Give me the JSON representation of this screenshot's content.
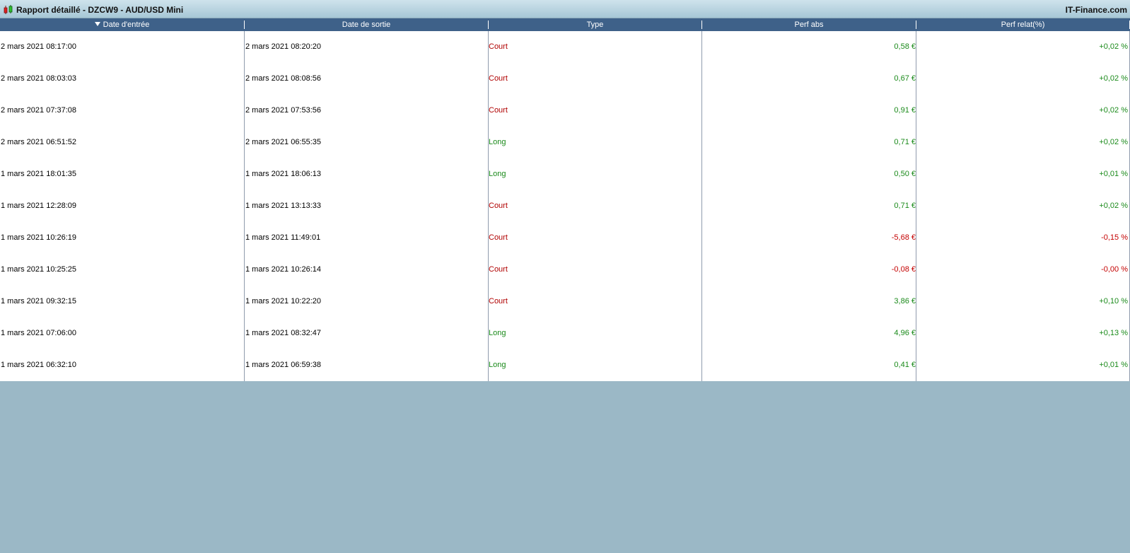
{
  "window": {
    "title": "Rapport détaillé - DZCW9 - AUD/USD Mini",
    "brand": "IT-Finance.com",
    "icon": "candlestick-chart-icon"
  },
  "colors": {
    "header_bg": "#3e6189",
    "background": "#9bb8c6",
    "positive": "#1a8a1a",
    "negative": "#c40000"
  },
  "table": {
    "columns": [
      "Date d'entrée",
      "Date de sortie",
      "Type",
      "Perf abs",
      "Perf relat(%)"
    ],
    "sorted_column": "Date d'entrée",
    "sort_direction": "descending",
    "rows": [
      {
        "entry": "2 mars 2021 08:17:00",
        "exit": "2 mars 2021 08:20:20",
        "type": "Court",
        "abs": "0,58 €",
        "rel": "+0,02 %",
        "sign": "pos"
      },
      {
        "entry": "2 mars 2021 08:03:03",
        "exit": "2 mars 2021 08:08:56",
        "type": "Court",
        "abs": "0,67 €",
        "rel": "+0,02 %",
        "sign": "pos"
      },
      {
        "entry": "2 mars 2021 07:37:08",
        "exit": "2 mars 2021 07:53:56",
        "type": "Court",
        "abs": "0,91 €",
        "rel": "+0,02 %",
        "sign": "pos"
      },
      {
        "entry": "2 mars 2021 06:51:52",
        "exit": "2 mars 2021 06:55:35",
        "type": "Long",
        "abs": "0,71 €",
        "rel": "+0,02 %",
        "sign": "pos"
      },
      {
        "entry": "1 mars 2021 18:01:35",
        "exit": "1 mars 2021 18:06:13",
        "type": "Long",
        "abs": "0,50 €",
        "rel": "+0,01 %",
        "sign": "pos"
      },
      {
        "entry": "1 mars 2021 12:28:09",
        "exit": "1 mars 2021 13:13:33",
        "type": "Court",
        "abs": "0,71 €",
        "rel": "+0,02 %",
        "sign": "pos"
      },
      {
        "entry": "1 mars 2021 10:26:19",
        "exit": "1 mars 2021 11:49:01",
        "type": "Court",
        "abs": "-5,68 €",
        "rel": "-0,15 %",
        "sign": "neg"
      },
      {
        "entry": "1 mars 2021 10:25:25",
        "exit": "1 mars 2021 10:26:14",
        "type": "Court",
        "abs": "-0,08 €",
        "rel": "-0,00 %",
        "sign": "neg"
      },
      {
        "entry": "1 mars 2021 09:32:15",
        "exit": "1 mars 2021 10:22:20",
        "type": "Court",
        "abs": "3,86 €",
        "rel": "+0,10 %",
        "sign": "pos"
      },
      {
        "entry": "1 mars 2021 07:06:00",
        "exit": "1 mars 2021 08:32:47",
        "type": "Long",
        "abs": "4,96 €",
        "rel": "+0,13 %",
        "sign": "pos"
      },
      {
        "entry": "1 mars 2021 06:32:10",
        "exit": "1 mars 2021 06:59:38",
        "type": "Long",
        "abs": "0,41 €",
        "rel": "+0,01 %",
        "sign": "pos"
      }
    ]
  }
}
